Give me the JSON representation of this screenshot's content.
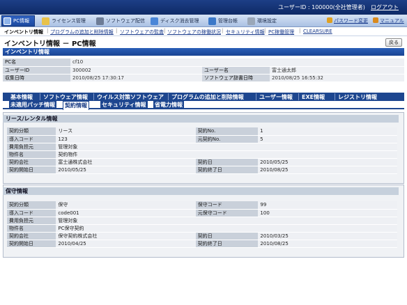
{
  "header": {
    "user_info": "ユーザーID : 100000(全社管理者)",
    "logout": "ログアウト"
  },
  "nav": {
    "tabs": [
      {
        "label": "PC情報",
        "active": true
      },
      {
        "label": "ライセンス管理"
      },
      {
        "label": "ソフトウェア配信"
      },
      {
        "label": "ディスク消去管理"
      },
      {
        "label": "管理台帳"
      },
      {
        "label": "環境設定"
      }
    ],
    "password_change": "パスワード変更",
    "manual": "マニュアル"
  },
  "subnav": [
    "インベントリ情報",
    "プログラムの追加と削除情報",
    "ソフトウェアの監査",
    "ソフトウェアの稼働状況",
    "セキュリティ情報",
    "PC稼働管理",
    "CLEARSURE"
  ],
  "page": {
    "title": "インベントリ情報 － PC情報",
    "back_button": "戻る",
    "section_title": "インベントリ情報"
  },
  "pc_info": {
    "pc_name_label": "PC名",
    "pc_name": "cf10",
    "user_id_label": "ユーザーID",
    "user_id": "300002",
    "user_name_label": "ユーザー名",
    "user_name": "富士通太郎",
    "collect_date_label": "収集日時",
    "collect_date": "2010/08/25 17:30:17",
    "dict_date_label": "ソフトウェア辞書日時",
    "dict_date": "2010/08/25 16:55:32"
  },
  "detail_tabs": {
    "row1": [
      "基本情報",
      "ソフトウェア情報",
      "ウイルス対策ソフトウェア",
      "プログラムの追加と削除情報",
      "ユーザー情報",
      "EXE情報",
      "レジストリ情報"
    ],
    "row2": [
      "未適用パッチ情報",
      "契約情報",
      "セキュリティ情報",
      "省電力情報"
    ],
    "active": "契約情報"
  },
  "lease": {
    "title": "リース/レンタル情報",
    "rows": [
      [
        "契約分類",
        "リース",
        "契約No.",
        "1"
      ],
      [
        "導入コード",
        "123",
        "元契約No.",
        "5"
      ],
      [
        "費用負担元",
        "管理対象",
        "",
        ""
      ],
      [
        "物件名",
        "契約物件",
        "",
        ""
      ],
      [
        "契約会社",
        "富士通株式会社",
        "契約日",
        "2010/05/25"
      ],
      [
        "契約開始日",
        "2010/05/25",
        "契約終了日",
        "2010/08/25"
      ]
    ]
  },
  "maintenance": {
    "title": "保守情報",
    "rows": [
      [
        "契約分類",
        "保守",
        "保守コード",
        "99"
      ],
      [
        "導入コード",
        "code001",
        "元保守コード",
        "100"
      ],
      [
        "費用負担元",
        "管理対象",
        "",
        ""
      ],
      [
        "物件名",
        "PC保守契約",
        "",
        ""
      ],
      [
        "契約会社",
        "保守契約株式会社",
        "契約日",
        "2010/03/25"
      ],
      [
        "契約開始日",
        "2010/04/25",
        "契約終了日",
        "2010/08/25"
      ]
    ]
  },
  "colors": {
    "header_blue": "#1d3f86",
    "tab_blue": "#1d468f",
    "label_gray": "#c9d0da"
  }
}
